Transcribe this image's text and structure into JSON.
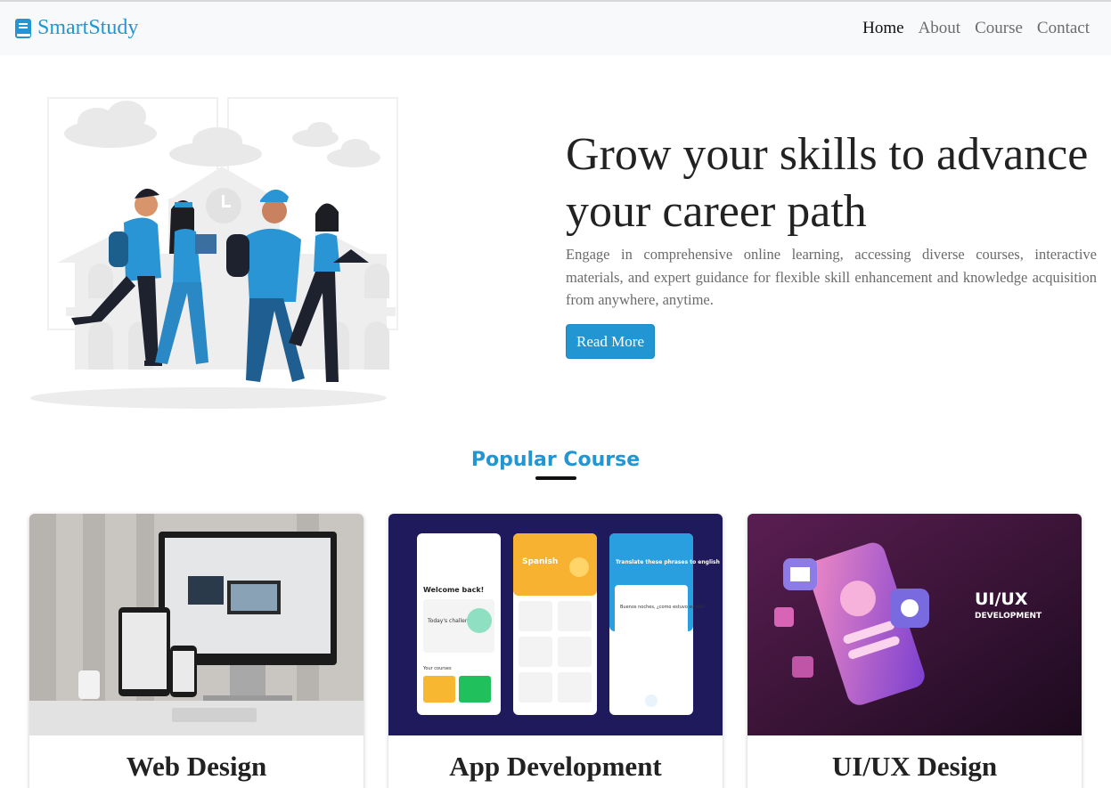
{
  "brand": {
    "name": "SmartStudy",
    "icon": "book-icon",
    "color": "#2196d3"
  },
  "nav": {
    "items": [
      {
        "label": "Home",
        "active": true
      },
      {
        "label": "About",
        "active": false
      },
      {
        "label": "Course",
        "active": false
      },
      {
        "label": "Contact",
        "active": false
      }
    ]
  },
  "hero": {
    "title": "Grow your skills to advance your career path",
    "text": "Engage in comprehensive online learning, accessing diverse courses, interactive materials, and expert guidance for flexible skill enhancement and knowledge acquisition from anywhere, anytime.",
    "button_label": "Read More",
    "illustration": "students-walking-illustration"
  },
  "popular": {
    "title": "Popular Course",
    "cards": [
      {
        "title": "Web Design",
        "image": "responsive-web-design-devices"
      },
      {
        "title": "App Development",
        "image": "language-learning-app-screens"
      },
      {
        "title": "UI/UX Design",
        "image": "ui-ux-development-phone",
        "image_heading": "UI/UX",
        "image_subheading": "DEVELOPMENT"
      }
    ]
  },
  "app_preview": {
    "screen1": {
      "greeting": "Welcome back!",
      "challenge": "Today's challenge",
      "courses": "Your courses"
    },
    "screen2": {
      "language": "Spanish"
    },
    "screen3": {
      "prompt": "Translate these phrases to english",
      "phrase": "Buenos noches, ¿como estuvo su día?"
    }
  },
  "colors": {
    "accent": "#2196d3",
    "navbar_bg": "#f8f9fa",
    "app_bg": "#1f1a5c",
    "uiux_bg": "#3a1338"
  }
}
